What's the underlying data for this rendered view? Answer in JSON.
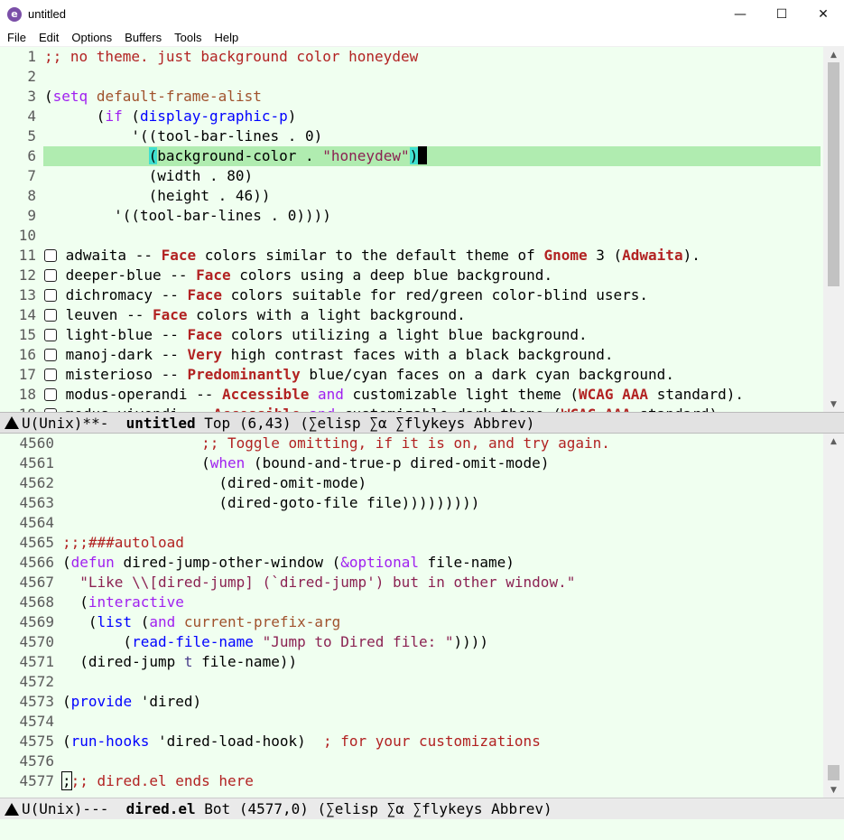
{
  "window": {
    "title": "untitled",
    "app_icon_letter": "e",
    "controls": {
      "minimize": "—",
      "maximize": "☐",
      "close": "✕"
    }
  },
  "menubar": [
    "File",
    "Edit",
    "Options",
    "Buffers",
    "Tools",
    "Help"
  ],
  "top_pane": {
    "lines": [
      {
        "n": "1",
        "segs": [
          {
            "t": ";; no theme. just background color honeydew",
            "c": "comment"
          }
        ]
      },
      {
        "n": "2",
        "segs": []
      },
      {
        "n": "3",
        "segs": [
          {
            "t": "(",
            "c": ""
          },
          {
            "t": "setq",
            "c": "kw"
          },
          {
            "t": " ",
            "c": ""
          },
          {
            "t": "default-frame-alist",
            "c": "var"
          }
        ]
      },
      {
        "n": "4",
        "segs": [
          {
            "t": "      (",
            "c": ""
          },
          {
            "t": "if",
            "c": "kw"
          },
          {
            "t": " (",
            "c": ""
          },
          {
            "t": "display-graphic-p",
            "c": "fn"
          },
          {
            "t": ")",
            "c": ""
          }
        ]
      },
      {
        "n": "5",
        "segs": [
          {
            "t": "          '((tool-bar-lines . 0)",
            "c": ""
          }
        ]
      },
      {
        "n": "6",
        "hl": true,
        "segs": [
          {
            "t": "            ",
            "c": ""
          },
          {
            "t": "(",
            "c": "parenmatch"
          },
          {
            "t": "background-color . ",
            "c": ""
          },
          {
            "t": "\"honeydew\"",
            "c": "str"
          },
          {
            "t": ")",
            "c": "parenmatch"
          },
          {
            "t": "",
            "c": "cursor"
          }
        ]
      },
      {
        "n": "7",
        "segs": [
          {
            "t": "            (width . 80)",
            "c": ""
          }
        ]
      },
      {
        "n": "8",
        "segs": [
          {
            "t": "            (height . 46))",
            "c": ""
          }
        ]
      },
      {
        "n": "9",
        "segs": [
          {
            "t": "        '((tool-bar-lines . 0))))",
            "c": ""
          }
        ]
      },
      {
        "n": "10",
        "segs": []
      },
      {
        "n": "11",
        "cb": true,
        "segs": [
          {
            "t": " adwaita -- ",
            "c": ""
          },
          {
            "t": "Face",
            "c": "bold"
          },
          {
            "t": " colors similar to the default theme of ",
            "c": ""
          },
          {
            "t": "Gnome",
            "c": "bold"
          },
          {
            "t": " 3 (",
            "c": ""
          },
          {
            "t": "Adwaita",
            "c": "bold"
          },
          {
            "t": ").",
            "c": ""
          }
        ]
      },
      {
        "n": "12",
        "cb": true,
        "segs": [
          {
            "t": " deeper-blue -- ",
            "c": ""
          },
          {
            "t": "Face",
            "c": "bold"
          },
          {
            "t": " colors using a deep blue background.",
            "c": ""
          }
        ]
      },
      {
        "n": "13",
        "cb": true,
        "segs": [
          {
            "t": " dichromacy -- ",
            "c": ""
          },
          {
            "t": "Face",
            "c": "bold"
          },
          {
            "t": " colors suitable for red/green color-blind users.",
            "c": ""
          }
        ]
      },
      {
        "n": "14",
        "cb": true,
        "segs": [
          {
            "t": " leuven -- ",
            "c": ""
          },
          {
            "t": "Face",
            "c": "bold"
          },
          {
            "t": " colors with a light background.",
            "c": ""
          }
        ]
      },
      {
        "n": "15",
        "cb": true,
        "segs": [
          {
            "t": " light-blue -- ",
            "c": ""
          },
          {
            "t": "Face",
            "c": "bold"
          },
          {
            "t": " colors utilizing a light blue background.",
            "c": ""
          }
        ]
      },
      {
        "n": "16",
        "cb": true,
        "segs": [
          {
            "t": " manoj-dark -- ",
            "c": ""
          },
          {
            "t": "Very",
            "c": "bold"
          },
          {
            "t": " high contrast faces with a black background.",
            "c": ""
          }
        ]
      },
      {
        "n": "17",
        "cb": true,
        "segs": [
          {
            "t": " misterioso -- ",
            "c": ""
          },
          {
            "t": "Predominantly",
            "c": "bold"
          },
          {
            "t": " blue/cyan faces on a dark cyan background.",
            "c": ""
          }
        ]
      },
      {
        "n": "18",
        "cb": true,
        "segs": [
          {
            "t": " modus-operandi -- ",
            "c": ""
          },
          {
            "t": "Accessible",
            "c": "bold"
          },
          {
            "t": " ",
            "c": ""
          },
          {
            "t": "and",
            "c": "kw"
          },
          {
            "t": " customizable light theme (",
            "c": ""
          },
          {
            "t": "WCAG AAA",
            "c": "bold"
          },
          {
            "t": " standard).",
            "c": ""
          }
        ]
      },
      {
        "n": "19",
        "cb": true,
        "segs": [
          {
            "t": " modus-vivendi -- ",
            "c": ""
          },
          {
            "t": "Accessible",
            "c": "bold"
          },
          {
            "t": " ",
            "c": ""
          },
          {
            "t": "and",
            "c": "kw"
          },
          {
            "t": " customizable dark theme (",
            "c": ""
          },
          {
            "t": "WCAG AAA",
            "c": "bold"
          },
          {
            "t": " standard).",
            "c": ""
          }
        ]
      }
    ]
  },
  "top_modeline": {
    "prefix": "U(Unix)**-  ",
    "buffer": "untitled",
    "suffix": " Top (6,43) (∑elisp ∑α ∑flykeys Abbrev)"
  },
  "bottom_pane": {
    "lines": [
      {
        "n": "4560",
        "segs": [
          {
            "t": "                ",
            "c": ""
          },
          {
            "t": ";; Toggle omitting, if it is on, and try again.",
            "c": "comment"
          }
        ]
      },
      {
        "n": "4561",
        "segs": [
          {
            "t": "                (",
            "c": ""
          },
          {
            "t": "when",
            "c": "kw"
          },
          {
            "t": " (bound-and-true-p dired-omit-mode)",
            "c": ""
          }
        ]
      },
      {
        "n": "4562",
        "segs": [
          {
            "t": "                  (dired-omit-mode)",
            "c": ""
          }
        ]
      },
      {
        "n": "4563",
        "segs": [
          {
            "t": "                  (dired-goto-file file)))))))))",
            "c": ""
          }
        ]
      },
      {
        "n": "4564",
        "segs": []
      },
      {
        "n": "4565",
        "segs": [
          {
            "t": ";;;###autoload",
            "c": "comment"
          }
        ]
      },
      {
        "n": "4566",
        "segs": [
          {
            "t": "(",
            "c": ""
          },
          {
            "t": "defun",
            "c": "kw"
          },
          {
            "t": " dired-jump-other-window (",
            "c": ""
          },
          {
            "t": "&optional",
            "c": "kw"
          },
          {
            "t": " file-name)",
            "c": ""
          }
        ]
      },
      {
        "n": "4567",
        "segs": [
          {
            "t": "  ",
            "c": ""
          },
          {
            "t": "\"Like \\\\[dired-jump] (`dired-jump') but in other window.\"",
            "c": "str"
          }
        ]
      },
      {
        "n": "4568",
        "segs": [
          {
            "t": "  (",
            "c": ""
          },
          {
            "t": "interactive",
            "c": "kw"
          }
        ]
      },
      {
        "n": "4569",
        "segs": [
          {
            "t": "   (",
            "c": ""
          },
          {
            "t": "list",
            "c": "fn"
          },
          {
            "t": " (",
            "c": ""
          },
          {
            "t": "and",
            "c": "kw"
          },
          {
            "t": " ",
            "c": ""
          },
          {
            "t": "current-prefix-arg",
            "c": "var"
          }
        ]
      },
      {
        "n": "4570",
        "segs": [
          {
            "t": "       (",
            "c": ""
          },
          {
            "t": "read-file-name",
            "c": "fn"
          },
          {
            "t": " ",
            "c": ""
          },
          {
            "t": "\"Jump to Dired file: \"",
            "c": "str"
          },
          {
            "t": "))))",
            "c": ""
          }
        ]
      },
      {
        "n": "4571",
        "segs": [
          {
            "t": "  (dired-jump ",
            "c": ""
          },
          {
            "t": "t",
            "c": "builtin"
          },
          {
            "t": " file-name))",
            "c": ""
          }
        ]
      },
      {
        "n": "4572",
        "segs": []
      },
      {
        "n": "4573",
        "segs": [
          {
            "t": "(",
            "c": ""
          },
          {
            "t": "provide",
            "c": "fn"
          },
          {
            "t": " 'dired)",
            "c": ""
          }
        ]
      },
      {
        "n": "4574",
        "segs": []
      },
      {
        "n": "4575",
        "segs": [
          {
            "t": "(",
            "c": ""
          },
          {
            "t": "run-hooks",
            "c": "fn"
          },
          {
            "t": " 'dired-load-hook)  ",
            "c": ""
          },
          {
            "t": "; for your customizations",
            "c": "comment"
          }
        ]
      },
      {
        "n": "4576",
        "segs": []
      },
      {
        "n": "4577",
        "segs": [
          {
            "t": ";",
            "c": "cursorbox"
          },
          {
            "t": ";; dired.el ends here",
            "c": "comment"
          }
        ]
      }
    ]
  },
  "bottom_modeline": {
    "prefix": "U(Unix)---  ",
    "buffer": "dired.el",
    "suffix": " Bot (4577,0) (∑elisp ∑α ∑flykeys Abbrev)"
  },
  "scrollbars": {
    "top": {
      "arrow_up": "▲",
      "arrow_down": "▼"
    },
    "bottom": {
      "arrow_up": "▲",
      "arrow_down": "▼"
    }
  }
}
